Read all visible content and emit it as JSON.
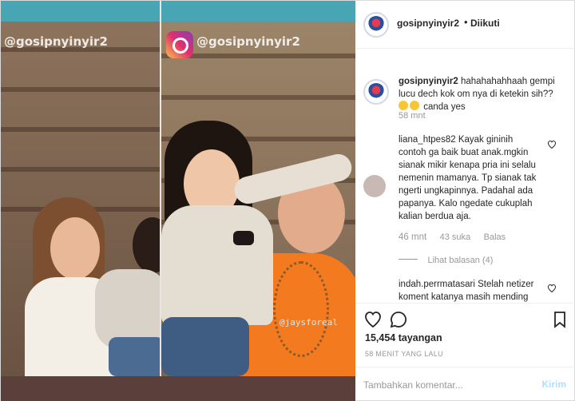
{
  "media": {
    "watermark_left": "@gosipnyinyir2",
    "watermark_right": "@gosipnyinyir2",
    "watermark_small": "@jaysforeal"
  },
  "header": {
    "username": "gosipnyinyir2",
    "dot": "•",
    "follow_status": "Diikuti"
  },
  "caption": {
    "username": "gosipnyinyir2",
    "text": "hahahahahhaah gempi lucu dech kok om nya di ketekin sih??",
    "text_after_emoji": "canda yes",
    "time": "58 mnt"
  },
  "comments": [
    {
      "username": "liana_htpes82",
      "text": "Kayak gininih contoh ga baik buat anak.mgkin sianak mikir kenapa pria ini selalu nemenin mamanya. Tp sianak tak ngerti ungkapinnya. Padahal ada papanya. Kalo ngedate cukuplah kalian berdua aja.",
      "time": "46 mnt",
      "likes": "43 suka",
      "reply": "Balas",
      "view_replies": "Lihat balasan (4)"
    },
    {
      "username": "indah.perrmatasari",
      "text": "Stelah netizer koment katanya masih mending"
    }
  ],
  "actions": {
    "views": "15,454 tayangan",
    "time_ago": "58 MENIT YANG LALU"
  },
  "comment_box": {
    "placeholder": "Tambahkan komentar...",
    "post_label": "Kirim"
  },
  "icons": [
    "heart-icon",
    "comment-icon",
    "bookmark-icon",
    "small-heart-icon"
  ]
}
